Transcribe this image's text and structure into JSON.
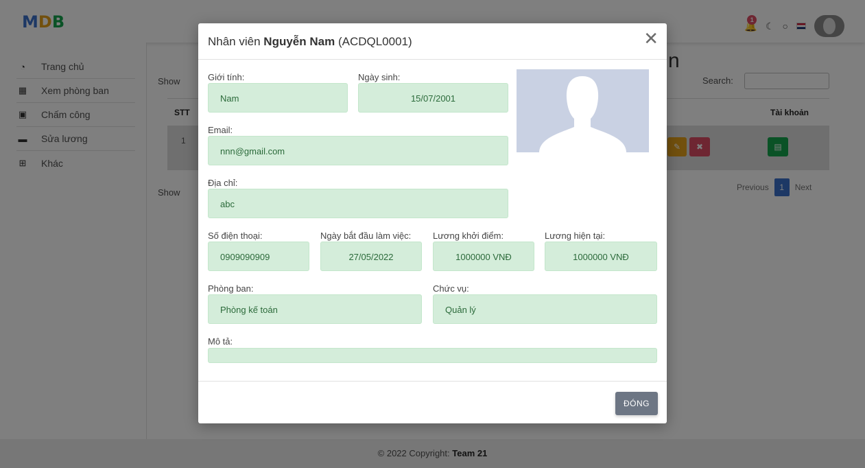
{
  "brand": {
    "logo": "MDB"
  },
  "navbar": {
    "notification_count": "1",
    "icons": [
      "bell-icon",
      "moon-icon",
      "github-icon",
      "flag-icon",
      "avatar"
    ]
  },
  "sidebar": {
    "items": [
      {
        "label": "Trang chủ",
        "icon": "dashboard-icon"
      },
      {
        "label": "Xem phòng ban",
        "icon": "building-icon"
      },
      {
        "label": "Chấm công",
        "icon": "calendar-icon"
      },
      {
        "label": "Sửa lương",
        "icon": "money-icon"
      },
      {
        "label": "Khác",
        "icon": "grid-icon"
      }
    ]
  },
  "main": {
    "title_visible": "n",
    "show_entries_top": "Show",
    "show_entries_bottom": "Show",
    "search_label": "Search:",
    "search_value": "",
    "table": {
      "headers": {
        "stt": "STT",
        "account": "Tài khoản"
      },
      "rows": [
        {
          "stt": "1"
        }
      ]
    },
    "pagination": {
      "previous": "Previous",
      "current": "1",
      "next": "Next"
    }
  },
  "modal": {
    "title_prefix": "Nhân viên",
    "title_name": "Nguyễn Nam",
    "title_code": "(ACDQL0001)",
    "fields": {
      "gender": {
        "label": "Giới tính:",
        "value": "Nam"
      },
      "dob": {
        "label": "Ngày sinh:",
        "value": "15/07/2001"
      },
      "email": {
        "label": "Email:",
        "value": "nnn@gmail.com"
      },
      "address": {
        "label": "Địa chỉ:",
        "value": "abc"
      },
      "phone": {
        "label": "Số điện thoại:",
        "value": "0909090909"
      },
      "start_date": {
        "label": "Ngày bắt đầu làm việc:",
        "value": "27/05/2022"
      },
      "base_salary": {
        "label": "Lương khởi điểm:",
        "value": "1000000 VNĐ"
      },
      "current_salary": {
        "label": "Lương hiện tại:",
        "value": "1000000 VNĐ"
      },
      "department": {
        "label": "Phòng ban:",
        "value": "Phòng kế toán"
      },
      "position": {
        "label": "Chức vụ:",
        "value": "Quản lý"
      },
      "description": {
        "label": "Mô tả:",
        "value": ""
      }
    },
    "close_button": "ĐÓNG"
  },
  "footer": {
    "text": "© 2022 Copyright:",
    "team": "Team 21"
  },
  "colors": {
    "field_bg": "#d4edda",
    "field_text": "#2b6a3a",
    "primary": "#3b71ca",
    "warning": "#e4a11b",
    "danger": "#dc4c64",
    "success": "#14a44d"
  }
}
